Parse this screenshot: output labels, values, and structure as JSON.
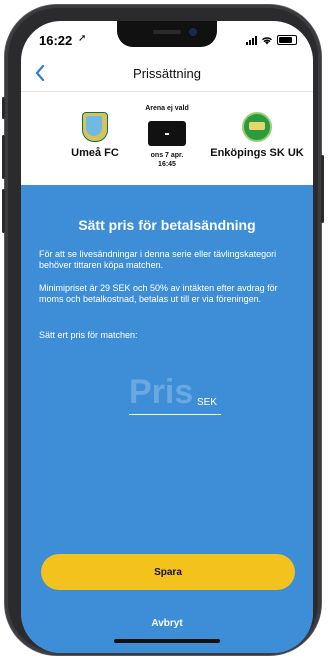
{
  "status_bar": {
    "time": "16:22",
    "location_icon": "location-arrow-icon"
  },
  "nav": {
    "back_icon": "chevron-left-icon",
    "title": "Prissättning"
  },
  "match": {
    "home_team": "Umeå FC",
    "away_team": "Enköpings SK UK",
    "arena": "Arena ej vald",
    "score": "-",
    "date": "ons 7 apr.",
    "time": "16:45"
  },
  "content": {
    "title": "Sätt pris för betalsändning",
    "paragraph1": "För att se livesändningar i denna serie eller tävlingskategori behöver tittaren köpa matchen.",
    "paragraph2": "Minimipriset är 29 SEK och 50% av intäkten efter avdrag för moms och betalkostnad, betalas ut till er via föreningen.",
    "paragraph3": "Sätt ert pris för matchen:",
    "price_placeholder": "Pris",
    "price_value": "",
    "currency": "SEK"
  },
  "actions": {
    "save_label": "Spara",
    "cancel_label": "Avbryt"
  },
  "colors": {
    "accent": "#3e8ed7",
    "button": "#f4c21d",
    "link": "#2f7fd0"
  }
}
